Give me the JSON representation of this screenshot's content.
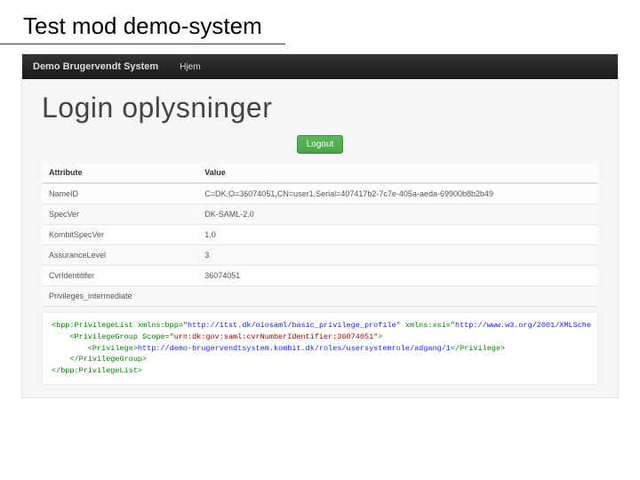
{
  "slide": {
    "title": "Test mod demo-system"
  },
  "navbar": {
    "brand": "Demo Brugervendt System",
    "items": [
      "Hjem"
    ]
  },
  "page": {
    "heading": "Login oplysninger",
    "logout_label": "Logout"
  },
  "table": {
    "headers": {
      "attr": "Attribute",
      "value": "Value"
    },
    "rows": [
      {
        "attr": "NameID",
        "value": "C=DK,O=36074051,CN=user1,Serial=407417b2-7c7e-405a-aeda-69900b8b2b49"
      },
      {
        "attr": "SpecVer",
        "value": "DK-SAML-2.0"
      },
      {
        "attr": "KombitSpecVer",
        "value": "1.0"
      },
      {
        "attr": "AssuranceLevel",
        "value": "3"
      },
      {
        "attr": "CvrIdentitifer",
        "value": "36074051"
      },
      {
        "attr": "Privileges_intermediate",
        "value": ""
      }
    ]
  },
  "xml": {
    "line1_a": "<bpp:PrivilegeList xmlns:bpp=\"",
    "line1_url1": "http://itst.dk/oiosaml/basic_privilege_profile",
    "line1_b": "\" xmlns:xsi=\"",
    "line1_url2": "http://www.w3.org/2001/XMLSche",
    "line2_a": "    <PrivilegeGroup Scope=\"",
    "line2_val": "urn:dk:gov:saml:cvrNumberIdentifier:36074051",
    "line2_b": "\">",
    "line3_a": "        <Privilege>",
    "line3_url": "http://demo-brugervendtsystem.kombit.dk/roles/usersystemrole/adgang/1",
    "line3_b": "</Privilege>",
    "line4": "    </PrivilegeGroup>",
    "line5": "</bpp:PrivilegeList>"
  }
}
